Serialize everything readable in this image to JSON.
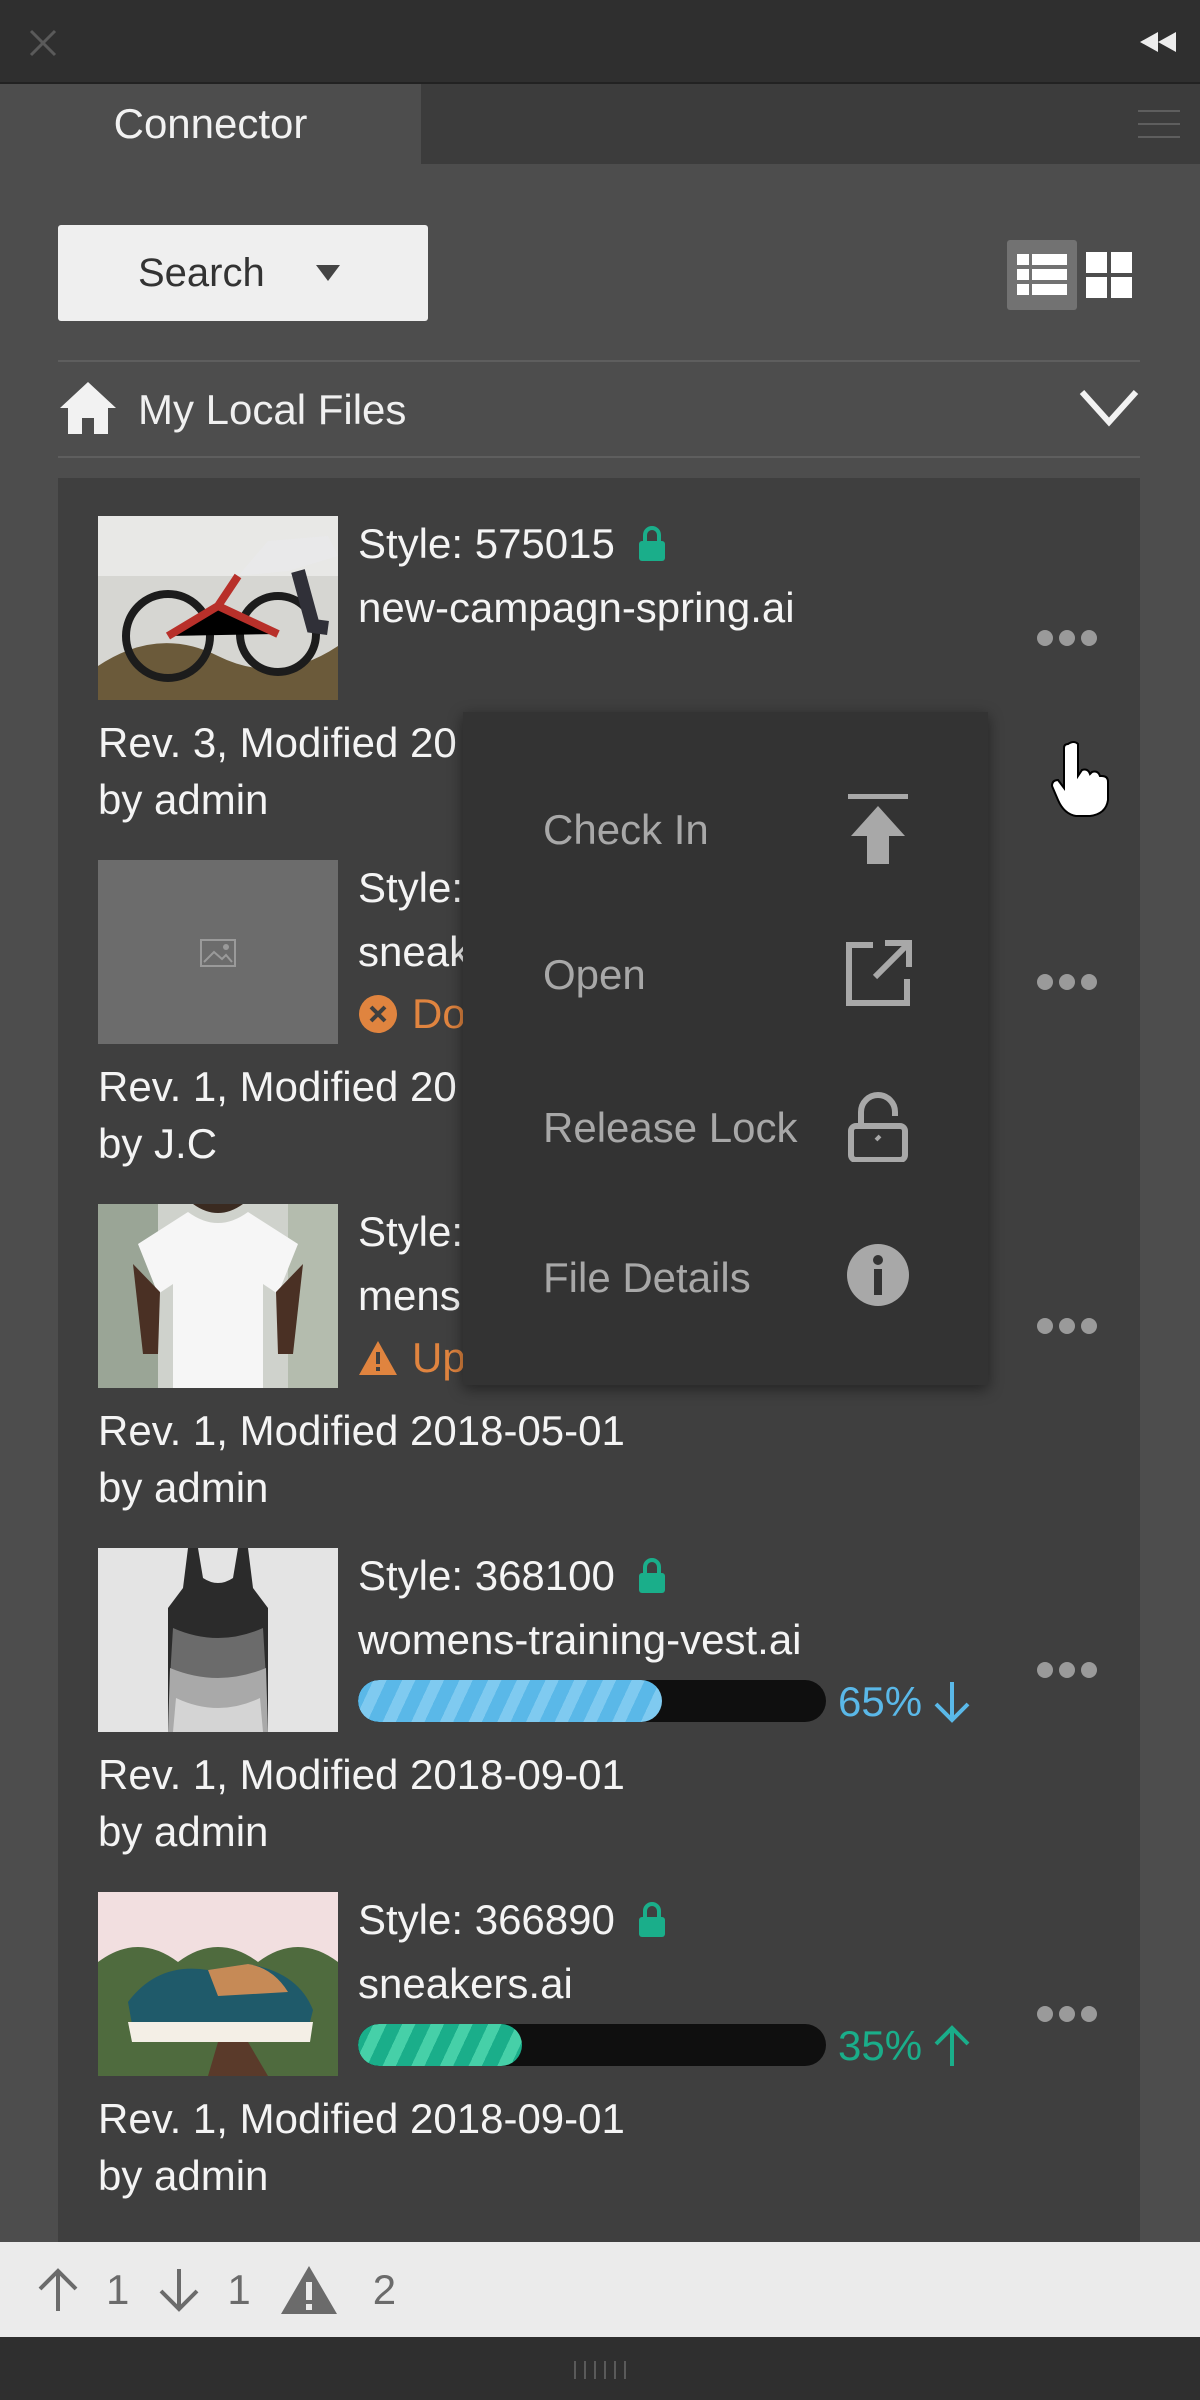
{
  "panel": {
    "tab_label": "Connector"
  },
  "toolbar": {
    "search_label": "Search",
    "caret_icon": "caret-down-icon",
    "views": [
      "list-view-icon",
      "grid-view-icon"
    ],
    "active_view": "list"
  },
  "breadcrumb": {
    "icon": "home-icon",
    "label": "My Local Files",
    "toggle_icon": "chevron-down-icon"
  },
  "files": [
    {
      "style": "Style: 575015",
      "locked": true,
      "name": "new-campagn-spring.ai",
      "rev": "Rev. 3, Modified 20",
      "by": "by admin",
      "thumb": "bmx-bike-photo"
    },
    {
      "style": "Style:",
      "locked": false,
      "name": "sneak",
      "status": "Do",
      "status_icon": "error-circle-icon",
      "rev": "Rev. 1, Modified 20",
      "by": "by J.C",
      "thumb": "image-placeholder-icon"
    },
    {
      "style": "Style:",
      "locked": false,
      "name": "mens",
      "status": "Up",
      "status_icon": "warning-triangle-icon",
      "rev": "Rev. 1, Modified 2018-05-01",
      "by": "by admin",
      "thumb": "white-tshirt-photo"
    },
    {
      "style": "Style: 368100",
      "locked": true,
      "name": "womens-training-vest.ai",
      "progress": 0.65,
      "progress_label": "65%",
      "direction": "down",
      "rev": "Rev. 1, Modified 2018-09-01",
      "by": "by admin",
      "thumb": "tank-tops-photo"
    },
    {
      "style": "Style: 366890",
      "locked": true,
      "name": "sneakers.ai",
      "progress": 0.35,
      "progress_label": "35%",
      "direction": "up",
      "rev": "Rev. 1, Modified 2018-09-01",
      "by": "by admin",
      "thumb": "sneaker-photo"
    }
  ],
  "context_menu": [
    {
      "label": "Check In",
      "icon": "check-in-icon"
    },
    {
      "label": "Open",
      "icon": "open-external-icon"
    },
    {
      "label": "Release Lock",
      "icon": "unlock-icon"
    },
    {
      "label": "File Details",
      "icon": "info-icon"
    }
  ],
  "footer": {
    "uploads": "1",
    "downloads": "1",
    "warnings": "2"
  },
  "colors": {
    "accent_green": "#1aae8a",
    "download_blue": "#5ab8e8",
    "warning_orange": "#e0843f",
    "panel_bg": "#4d4d4d",
    "list_bg": "#3f3f3f",
    "menu_bg": "#333333"
  }
}
